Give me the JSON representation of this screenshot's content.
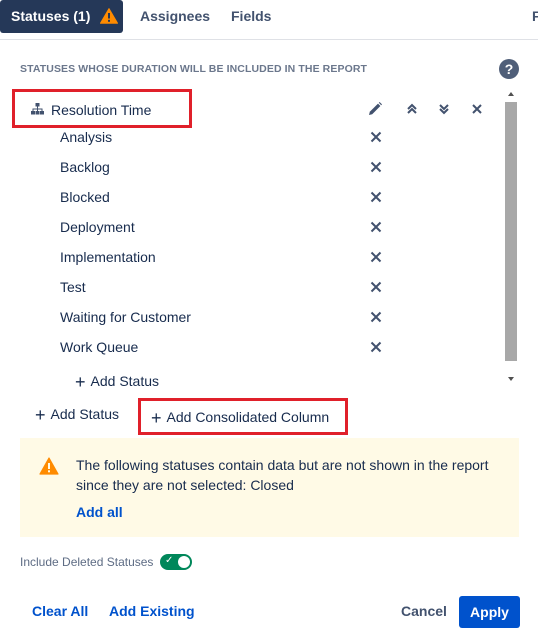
{
  "tabs": [
    {
      "label": "Statuses (1)",
      "active": true,
      "icon": "warning-icon"
    },
    {
      "label": "Assignees",
      "active": false
    },
    {
      "label": "Fields",
      "active": false
    },
    {
      "label": "F",
      "active": false
    }
  ],
  "section_title": "STATUSES WHOSE DURATION WILL BE INCLUDED IN THE REPORT",
  "help_icon": "?",
  "group": {
    "label": "Resolution Time",
    "icon": "hierarchy-icon",
    "actions": [
      "pencil-icon",
      "double-chevron-up-icon",
      "double-chevron-down-icon",
      "close-icon"
    ]
  },
  "statuses": [
    {
      "label": "Analysis"
    },
    {
      "label": "Backlog"
    },
    {
      "label": "Blocked"
    },
    {
      "label": "Deployment"
    },
    {
      "label": "Implementation"
    },
    {
      "label": "Test"
    },
    {
      "label": "Waiting for Customer"
    },
    {
      "label": "Work Queue"
    }
  ],
  "add_status_inner": "Add Status",
  "add_status_outer": "Add Status",
  "add_consolidated": "Add Consolidated Column",
  "warning": {
    "text": "The following statuses contain data but are not shown in the report since they are not selected: Closed",
    "add_all": "Add all"
  },
  "toggle": {
    "label": "Include Deleted Statuses",
    "on": true
  },
  "footer": {
    "clear_all": "Clear All",
    "add_existing": "Add Existing",
    "cancel": "Cancel",
    "apply": "Apply"
  },
  "colors": {
    "active_tab": "#253858",
    "link": "#0052cc",
    "highlight_box": "#e0202a",
    "warning_bg": "#fffae6",
    "toggle_on": "#00875a",
    "apply_bg": "#0052cc"
  }
}
